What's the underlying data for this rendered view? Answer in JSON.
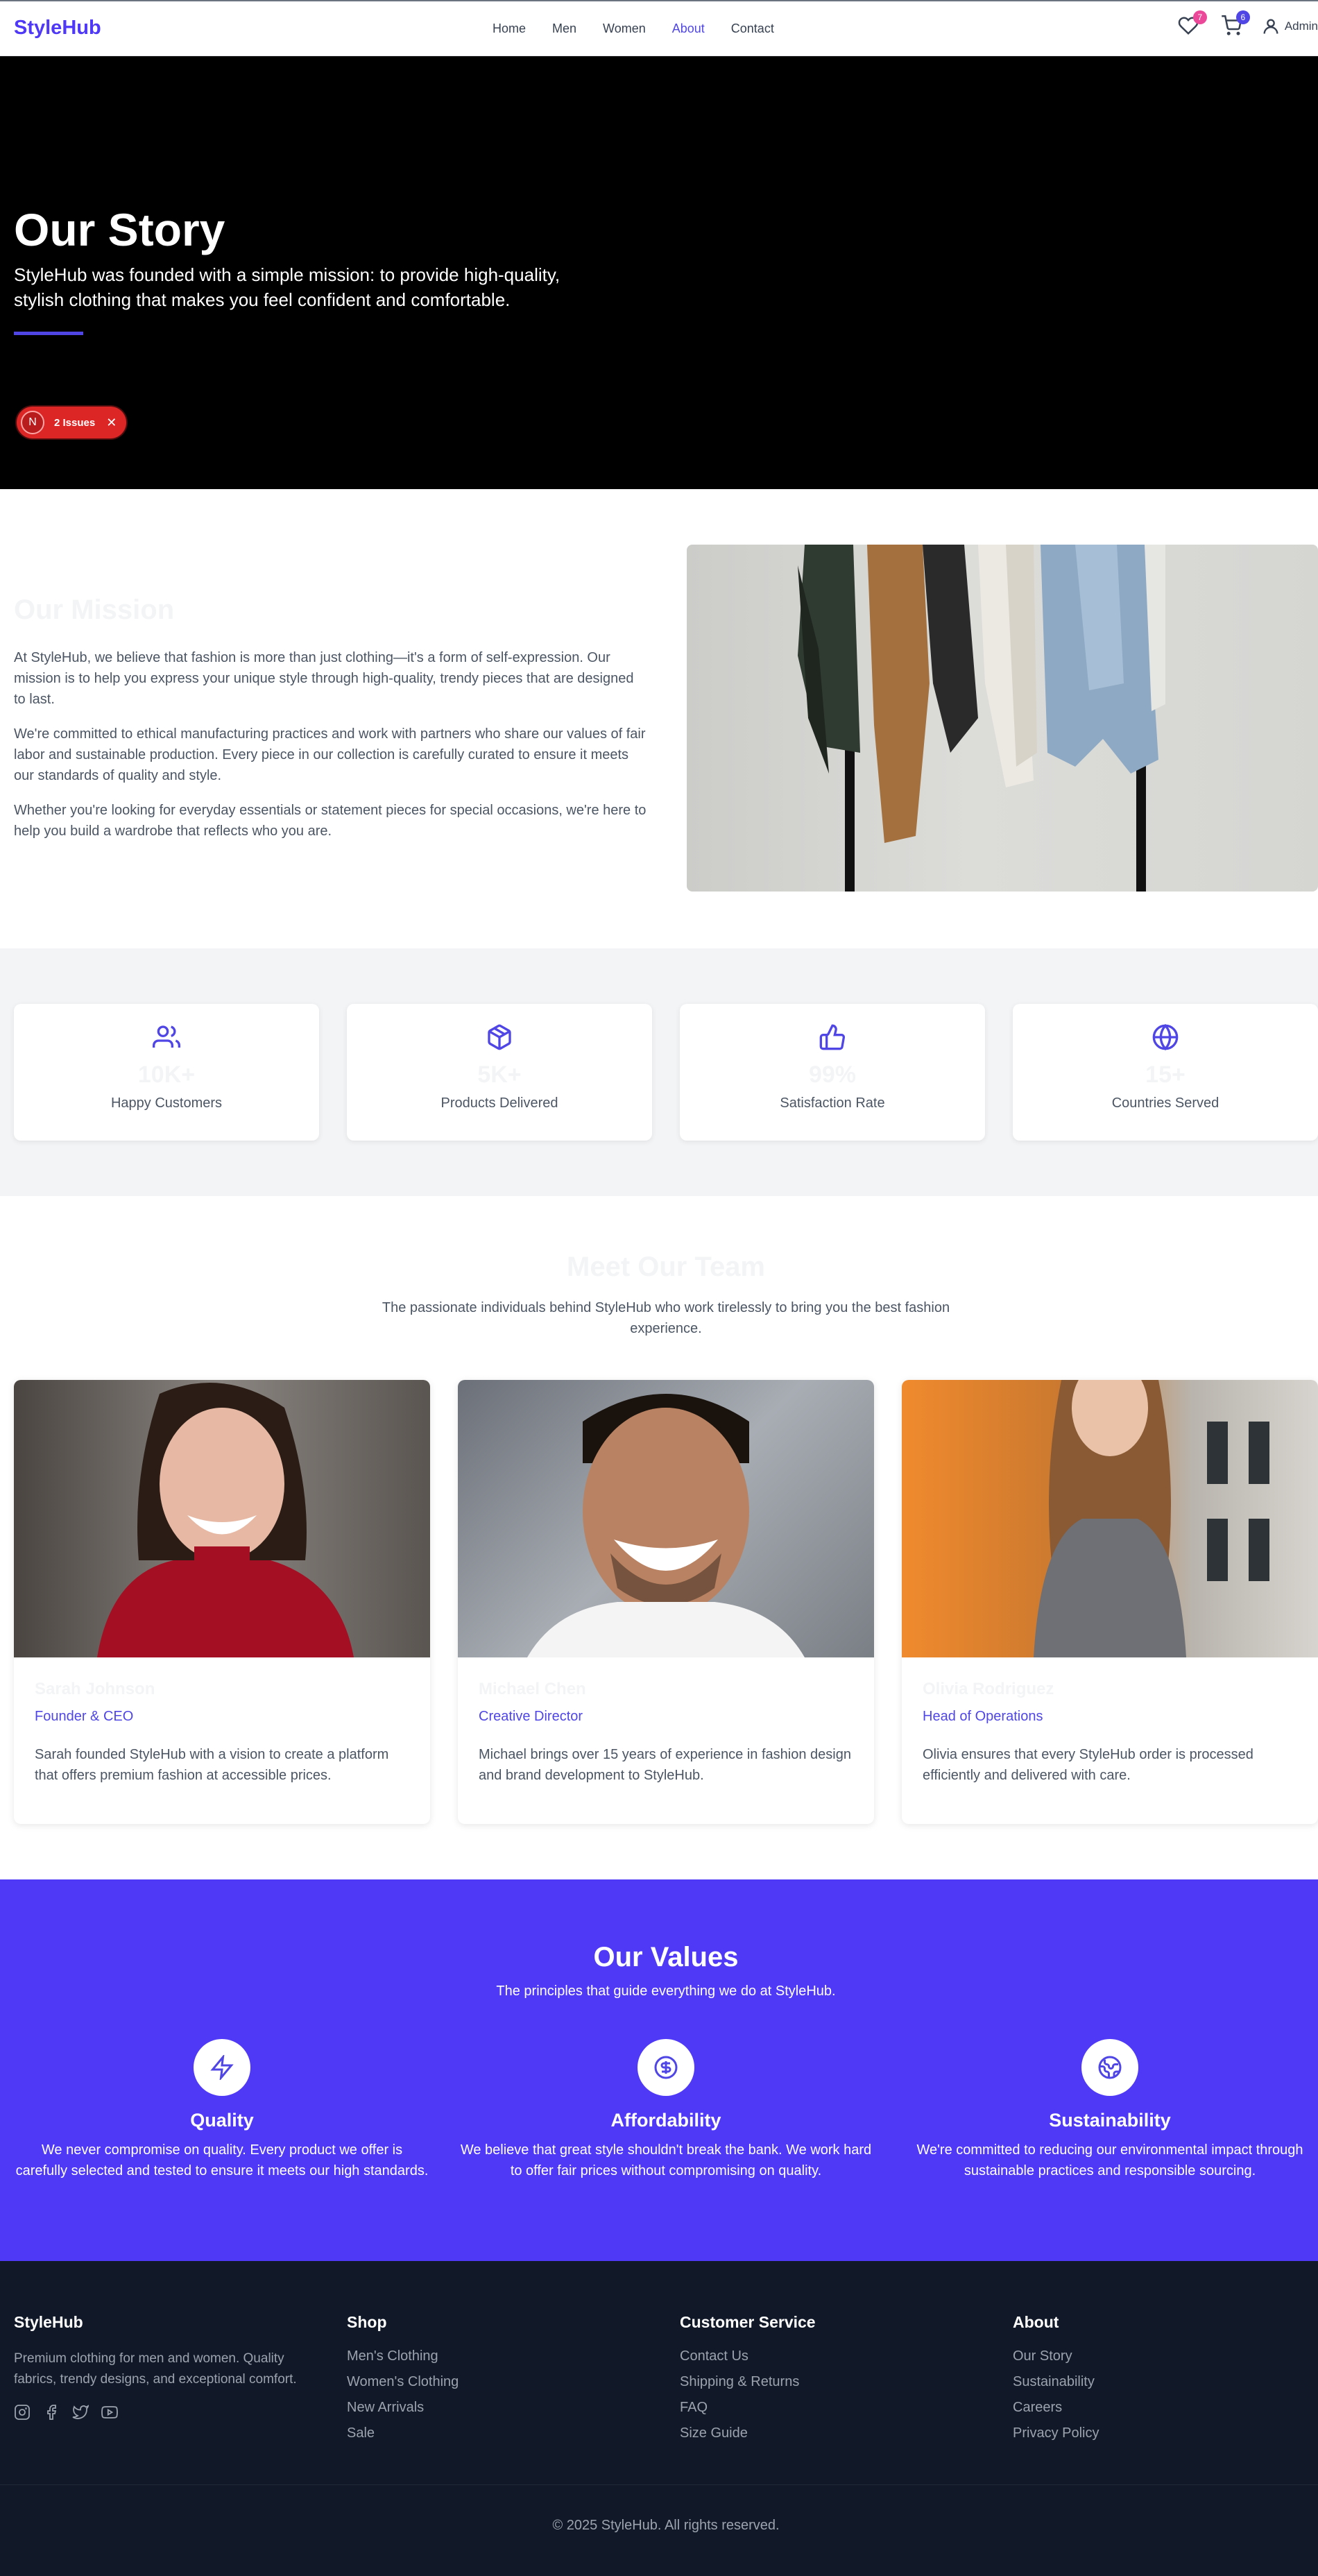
{
  "header": {
    "logo": "StyleHub",
    "nav": [
      {
        "label": "Home"
      },
      {
        "label": "Men"
      },
      {
        "label": "Women"
      },
      {
        "label": "About",
        "active": true
      },
      {
        "label": "Contact"
      }
    ],
    "wishlist_count": "7",
    "cart_count": "6",
    "user_label": "Admin"
  },
  "hero": {
    "title": "Our Story",
    "subtitle": "StyleHub was founded with a simple mission: to provide high-quality, stylish clothing that makes you feel confident and comfortable.",
    "issues_label": "2 Issues",
    "issues_logo": "N"
  },
  "mission": {
    "title": "Our Mission",
    "paragraphs": [
      "At StyleHub, we believe that fashion is more than just clothing—it's a form of self-expression. Our mission is to help you express your unique style through high-quality, trendy pieces that are designed to last.",
      "We're committed to ethical manufacturing practices and work with partners who share our values of fair labor and sustainable production. Every piece in our collection is carefully curated to ensure it meets our standards of quality and style.",
      "Whether you're looking for everyday essentials or statement pieces for special occasions, we're here to help you build a wardrobe that reflects who you are."
    ]
  },
  "stats": [
    {
      "icon": "users-icon",
      "value": "10K+",
      "label": "Happy Customers"
    },
    {
      "icon": "package-icon",
      "value": "5K+",
      "label": "Products Delivered"
    },
    {
      "icon": "thumbs-up-icon",
      "value": "99%",
      "label": "Satisfaction Rate"
    },
    {
      "icon": "globe-icon",
      "value": "15+",
      "label": "Countries Served"
    }
  ],
  "team": {
    "title": "Meet Our Team",
    "subtitle": "The passionate individuals behind StyleHub who work tirelessly to bring you the best fashion experience.",
    "members": [
      {
        "name": "Sarah Johnson",
        "role": "Founder & CEO",
        "bio": "Sarah founded StyleHub with a vision to create a platform that offers premium fashion at accessible prices."
      },
      {
        "name": "Michael Chen",
        "role": "Creative Director",
        "bio": "Michael brings over 15 years of experience in fashion design and brand development to StyleHub."
      },
      {
        "name": "Olivia Rodriguez",
        "role": "Head of Operations",
        "bio": "Olivia ensures that every StyleHub order is processed efficiently and delivered with care."
      }
    ]
  },
  "values": {
    "title": "Our Values",
    "subtitle": "The principles that guide everything we do at StyleHub.",
    "items": [
      {
        "icon": "lightning-icon",
        "title": "Quality",
        "text": "We never compromise on quality. Every product we offer is carefully selected and tested to ensure it meets our high standards."
      },
      {
        "icon": "dollar-icon",
        "title": "Affordability",
        "text": "We believe that great style shouldn't break the bank. We work hard to offer fair prices without compromising on quality."
      },
      {
        "icon": "earth-icon",
        "title": "Sustainability",
        "text": "We're committed to reducing our environmental impact through sustainable practices and responsible sourcing."
      }
    ]
  },
  "footer": {
    "brand": "StyleHub",
    "description": "Premium clothing for men and women. Quality fabrics, trendy designs, and exceptional comfort.",
    "columns": [
      {
        "title": "Shop",
        "links": [
          "Men's Clothing",
          "Women's Clothing",
          "New Arrivals",
          "Sale"
        ]
      },
      {
        "title": "Customer Service",
        "links": [
          "Contact Us",
          "Shipping & Returns",
          "FAQ",
          "Size Guide"
        ]
      },
      {
        "title": "About",
        "links": [
          "Our Story",
          "Sustainability",
          "Careers",
          "Privacy Policy"
        ]
      }
    ],
    "copyright": "© 2025 StyleHub. All rights reserved."
  },
  "colors": {
    "brand": "#4f39f6",
    "accent": "#4f46e5",
    "footer_bg": "#111827",
    "badge_pink": "#ec4899",
    "issue_red": "#dc2626"
  }
}
